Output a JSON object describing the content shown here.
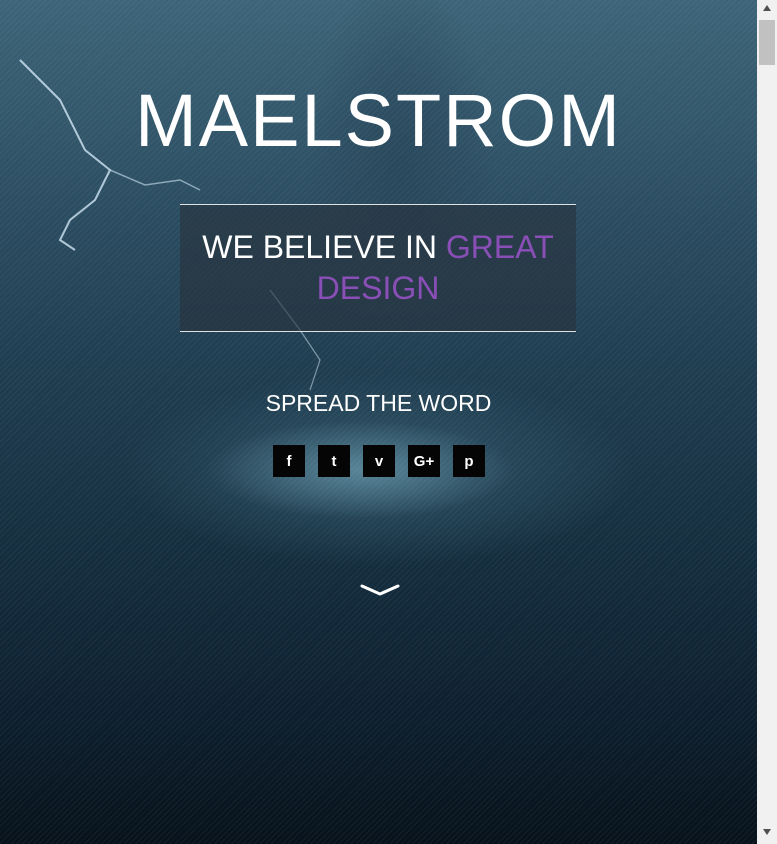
{
  "hero": {
    "title": "MAELSTROM",
    "tagline_prefix": "WE BELIEVE IN ",
    "tagline_accent": "GREAT DESIGN",
    "spread_label": "SPREAD THE WORD"
  },
  "social": [
    {
      "name": "facebook",
      "glyph": "f"
    },
    {
      "name": "twitter",
      "glyph": "t"
    },
    {
      "name": "vimeo",
      "glyph": "v"
    },
    {
      "name": "google-plus",
      "glyph": "G+"
    },
    {
      "name": "pinterest",
      "glyph": "p"
    }
  ],
  "colors": {
    "accent": "#8a4fb7",
    "text": "#ffffff",
    "social_bg": "#050505"
  },
  "icons": {
    "scroll_down": "chevron-down-icon"
  }
}
